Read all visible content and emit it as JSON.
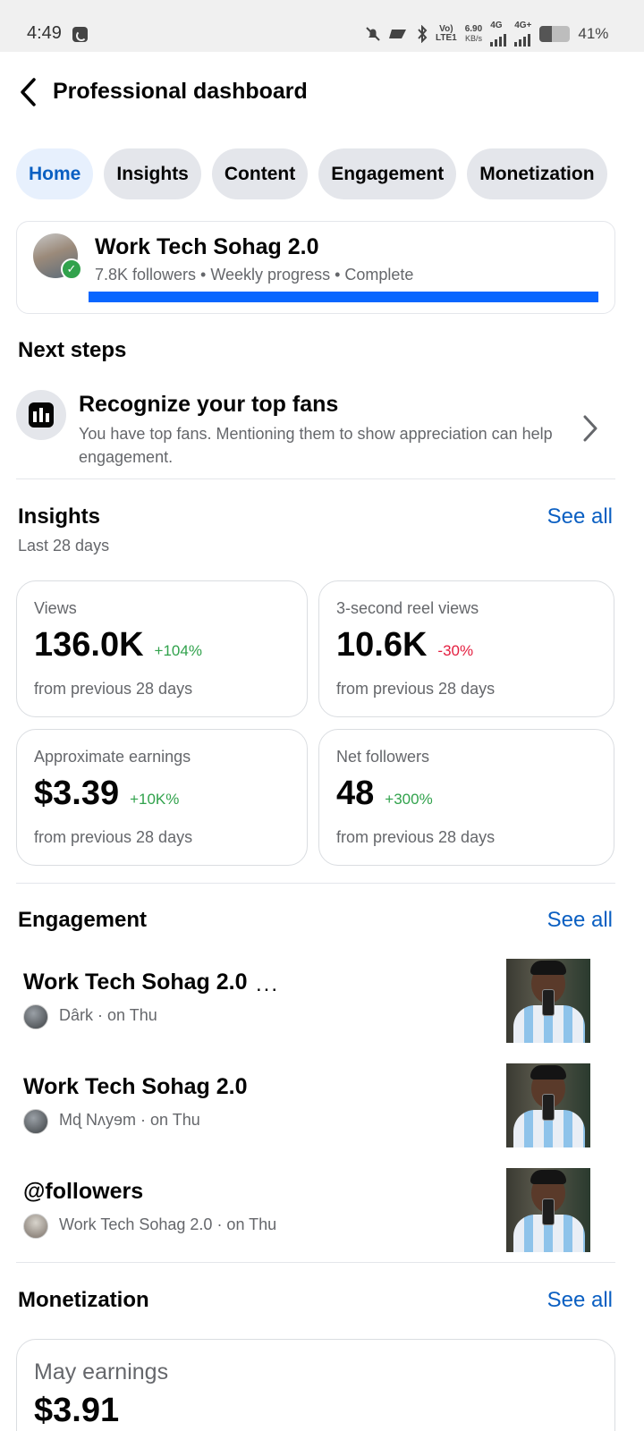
{
  "status_bar": {
    "time": "4:49",
    "net_speed_value": "6.90",
    "net_speed_unit": "KB/s",
    "volte_top": "Vo)",
    "volte_bottom": "LTE1",
    "sim1_type": "4G",
    "sim2_type": "4G+",
    "battery_percent": "41%",
    "battery_level": 0.41
  },
  "header": {
    "title": "Professional dashboard"
  },
  "tabs": [
    {
      "label": "Home",
      "active": true
    },
    {
      "label": "Insights",
      "active": false
    },
    {
      "label": "Content",
      "active": false
    },
    {
      "label": "Engagement",
      "active": false
    },
    {
      "label": "Monetization",
      "active": false
    }
  ],
  "profile": {
    "name": "Work Tech Sohag 2.0",
    "meta": "7.8K followers • Weekly progress • Complete",
    "progress": 1.0
  },
  "next_steps": {
    "title": "Next steps",
    "item": {
      "title": "Recognize your top fans",
      "description": "You have top fans. Mentioning them to show appreciation can help engagement."
    }
  },
  "insights": {
    "title": "Insights",
    "see_all": "See all",
    "period": "Last 28 days",
    "metrics": [
      {
        "label": "Views",
        "value": "136.0K",
        "change": "+104%",
        "trend": "up",
        "sub": "from previous 28 days"
      },
      {
        "label": "3-second reel views",
        "value": "10.6K",
        "change": "-30%",
        "trend": "down",
        "sub": "from previous 28 days"
      },
      {
        "label": "Approximate earnings",
        "value": "$3.39",
        "change": "+10K%",
        "trend": "up",
        "sub": "from previous 28 days"
      },
      {
        "label": "Net followers",
        "value": "48",
        "change": "+300%",
        "trend": "up",
        "sub": "from previous 28 days"
      }
    ]
  },
  "engagement": {
    "title": "Engagement",
    "see_all": "See all",
    "more_indicator": "...",
    "items": [
      {
        "title": "Work Tech Sohag 2.0",
        "sub": "Dârk · on Thu"
      },
      {
        "title": "Work Tech Sohag 2.0",
        "sub": "Mɖ Nʌyɘm · on Thu"
      },
      {
        "title": "@followers",
        "sub": "Work Tech Sohag 2.0 · on Thu"
      }
    ]
  },
  "monetization": {
    "title": "Monetization",
    "see_all": "See all",
    "card_label": "May earnings",
    "card_value": "$3.91"
  },
  "colors": {
    "accent": "#0a5fc2",
    "progress": "#0866ff",
    "positive": "#31a24c",
    "negative": "#e41e3f"
  },
  "icons": {
    "back": "chevron-left-icon",
    "next_step": "bar-chart-icon",
    "step_chevron": "chevron-right-icon",
    "verified": "check-badge-icon"
  }
}
